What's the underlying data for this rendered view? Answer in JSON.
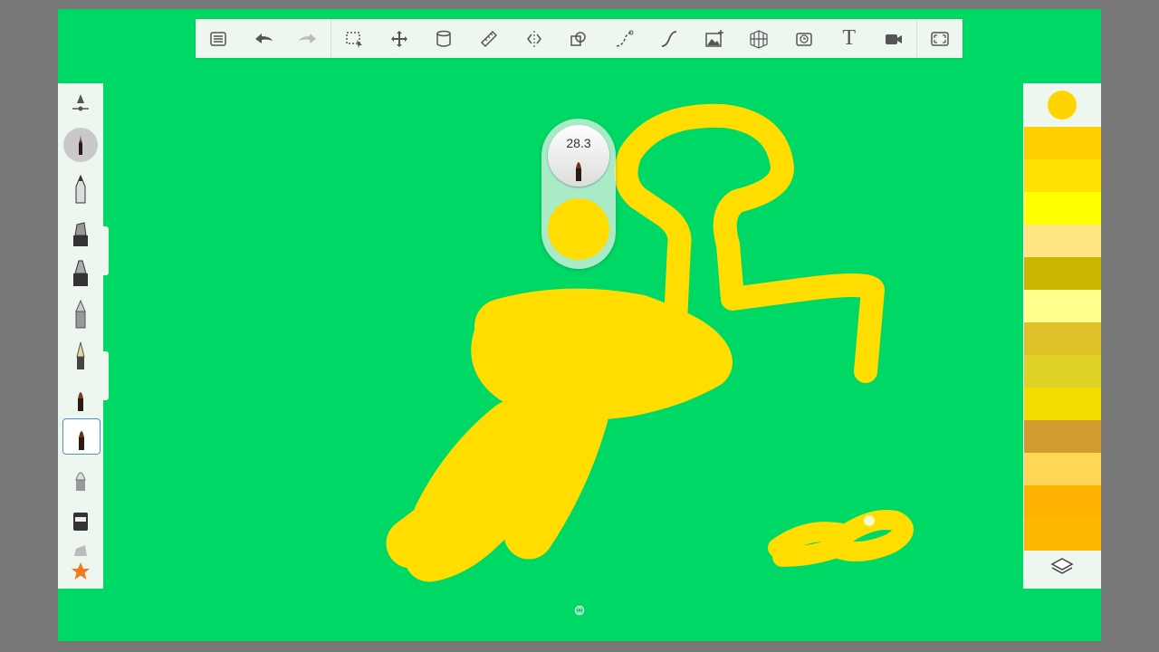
{
  "brush": {
    "size_label": "28.3",
    "color": "#ffdd00"
  },
  "colors": {
    "canvas": "#00d865",
    "stroke": "#ffdd00"
  },
  "toolbar": {
    "items": [
      "list-icon",
      "undo-icon",
      "redo-icon",
      "selection-icon",
      "transform-icon",
      "bucket-fill-icon",
      "ruler-icon",
      "symmetry-icon",
      "shapes-icon",
      "curve-icon",
      "guide-icon",
      "import-image-icon",
      "perspective-icon",
      "time-lapse-icon",
      "text-icon",
      "record-icon",
      "fullscreen-icon"
    ],
    "text_label": "T"
  },
  "palette": {
    "current": "#ffd500",
    "swatches": [
      "#ffd000",
      "#ffe000",
      "#ffff00",
      "#ffe680",
      "#cbb600",
      "#ffff8c",
      "#dfc22a",
      "#dfd227",
      "#f5dc00",
      "#d39a30",
      "#ffd655",
      "#ffb300",
      "#ffb800"
    ]
  },
  "brushes": [
    "brush-size-slider-icon",
    "paintbrush-icon",
    "pencil-icon",
    "marker-icon",
    "ink-pen-icon",
    "ballpoint-pen-icon",
    "fountain-pen-icon",
    "paint-brush-small-icon",
    "paint-brush-selected-icon",
    "airbrush-icon",
    "eraser-icon",
    "smear-icon",
    "favorites-star-icon"
  ]
}
